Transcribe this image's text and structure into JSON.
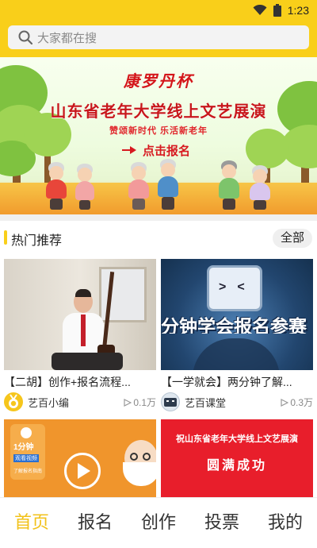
{
  "status_bar": {
    "time": "1:23",
    "icons": [
      "wifi-icon",
      "battery-icon"
    ]
  },
  "search": {
    "placeholder": "大家都在搜",
    "icon": "search-icon"
  },
  "banner": {
    "brand": "康罗丹杯",
    "title": "山东省老年大学线上文艺展演",
    "subtitle": "赞颂新时代  乐活新老年",
    "cta": "点击报名",
    "cta_icon": "pointing-hand-icon"
  },
  "section": {
    "title": "热门推荐",
    "all_label": "全部"
  },
  "cards": [
    {
      "title": "【二胡】创作+报名流程...",
      "author": "艺百小编",
      "views": "0.1万",
      "avatar": "medal-avatar"
    },
    {
      "title": "【一学就会】两分钟了解...",
      "author": "艺百课堂",
      "views": "0.3万",
      "avatar": "robot-avatar"
    },
    {
      "title": "",
      "author": "",
      "views": "",
      "thumb_text": [
        "1分钟",
        "观看视频",
        "了解报名指南"
      ]
    },
    {
      "title": "",
      "author": "",
      "views": "",
      "thumb_text": [
        "祝山东省老年大学线上文艺展演",
        "圆满成功"
      ]
    }
  ],
  "card2_overlay": "分钟学会报名参赛",
  "nav": {
    "tabs": [
      "首页",
      "报名",
      "创作",
      "投票",
      "我的"
    ],
    "active": "首页"
  },
  "colors": {
    "accent": "#f9cf1a",
    "brand_red": "#d4151a",
    "nav_active": "#f2c21a",
    "play_orange": "#f0952c"
  }
}
